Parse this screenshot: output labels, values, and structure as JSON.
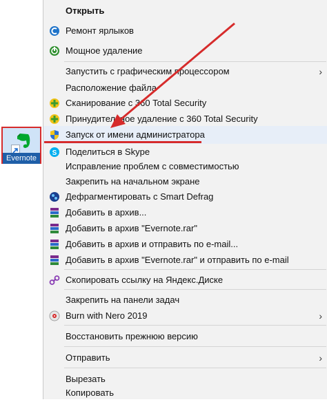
{
  "desktop_icon": {
    "label": "Evernote"
  },
  "menu": {
    "items": [
      {
        "label": "Открыть",
        "icon": "none"
      },
      {
        "label": "Ремонт ярлыков",
        "icon": "repair-icon"
      },
      {
        "label": "Мощное удаление",
        "icon": "uninstall-icon"
      },
      {
        "label": "Запустить с графическим процессором",
        "icon": "none",
        "submenu": "›"
      },
      {
        "label": "Расположение файла",
        "icon": "none"
      },
      {
        "label": "Сканирование с 360 Total Security",
        "icon": "360-shield-icon"
      },
      {
        "label": "Принудительное удаление с 360 Total Security",
        "icon": "360-shield-icon"
      },
      {
        "label": "Запуск от имени администратора",
        "icon": "uac-shield-icon"
      },
      {
        "label": "Поделиться в Skype",
        "icon": "skype-icon"
      },
      {
        "label": "Исправление проблем с совместимостью",
        "icon": "none"
      },
      {
        "label": "Закрепить на начальном экране",
        "icon": "none"
      },
      {
        "label": "Дефрагментировать с Smart Defrag",
        "icon": "defrag-icon"
      },
      {
        "label": "Добавить в архив...",
        "icon": "winrar-icon"
      },
      {
        "label": "Добавить в архив \"Evernote.rar\"",
        "icon": "winrar-icon"
      },
      {
        "label": "Добавить в архив и отправить по e-mail...",
        "icon": "winrar-icon"
      },
      {
        "label": "Добавить в архив \"Evernote.rar\" и отправить по e-mail",
        "icon": "winrar-icon"
      },
      {
        "label": "Скопировать ссылку на Яндекс.Диске",
        "icon": "yandex-link-icon"
      },
      {
        "label": "Закрепить на панели задач",
        "icon": "none"
      },
      {
        "label": "Burn with Nero 2019",
        "icon": "nero-icon",
        "submenu": "›"
      },
      {
        "label": "Восстановить прежнюю версию",
        "icon": "none"
      },
      {
        "label": "Отправить",
        "icon": "none",
        "submenu": "›"
      },
      {
        "label": "Вырезать",
        "icon": "none"
      },
      {
        "label": "Копировать",
        "icon": "none"
      }
    ]
  },
  "colors": {
    "annotation_red": "#d62b2b",
    "menu_bg": "#f2f2f2"
  }
}
